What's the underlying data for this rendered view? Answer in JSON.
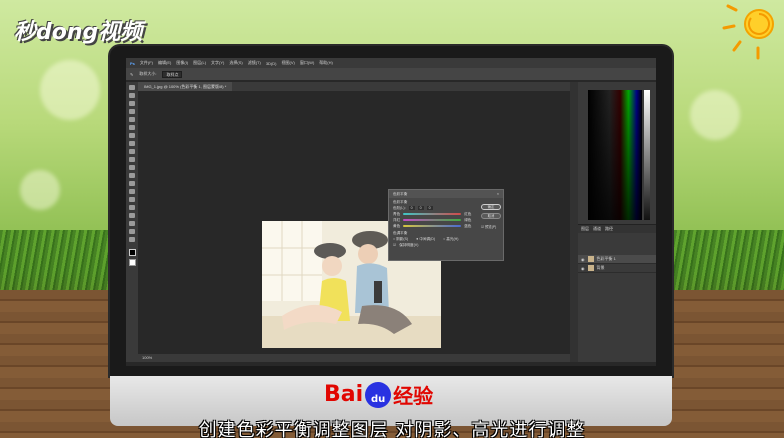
{
  "watermark": {
    "logo_text": "秒dong视频"
  },
  "photoshop": {
    "menu": [
      "文件(F)",
      "编辑(E)",
      "图像(I)",
      "图层(L)",
      "文字(Y)",
      "选择(S)",
      "滤镜(T)",
      "3D(D)",
      "视图(V)",
      "窗口(W)",
      "帮助(H)"
    ],
    "options_bar": {
      "sample_size_label": "取样大小:",
      "sample_size_value": "取样点"
    },
    "document_tab": "IMG_1.jpg @ 100% (色彩平衡 1, 图层蒙版/8) *",
    "status_bar": "100%",
    "layers_panel": {
      "tabs": [
        "图层",
        "通道",
        "路径"
      ],
      "layers": [
        {
          "name": "色彩平衡 1",
          "active": true
        },
        {
          "name": "背景",
          "active": false
        }
      ]
    }
  },
  "color_balance_dialog": {
    "title": "色彩平衡",
    "section_color_balance": "色彩平衡",
    "levels_label": "色阶(L):",
    "levels_values": [
      "0",
      "0",
      "0"
    ],
    "sliders": [
      {
        "left": "青色",
        "right": "红色",
        "color": "#d24a4a"
      },
      {
        "left": "洋红",
        "right": "绿色",
        "color": "#3fae3f"
      },
      {
        "left": "黄色",
        "right": "蓝色",
        "color": "#4a6ad2"
      }
    ],
    "section_tone_balance": "色调平衡",
    "tones": [
      "阴影(S)",
      "中间调(D)",
      "高光(H)"
    ],
    "preserve_luminosity": "保持明度(V)",
    "ok_label": "确定",
    "cancel_label": "取消",
    "preview_label": "预览(P)"
  },
  "branding": {
    "baidu_left": "Bai",
    "baidu_paw": "du",
    "baidu_right": "经验"
  },
  "subtitle": "创建色彩平衡调整图层  对阴影、高光进行调整",
  "colors": {
    "baidu_red": "#e10601",
    "baidu_blue": "#2932e1",
    "ps_dark": "#282828"
  }
}
